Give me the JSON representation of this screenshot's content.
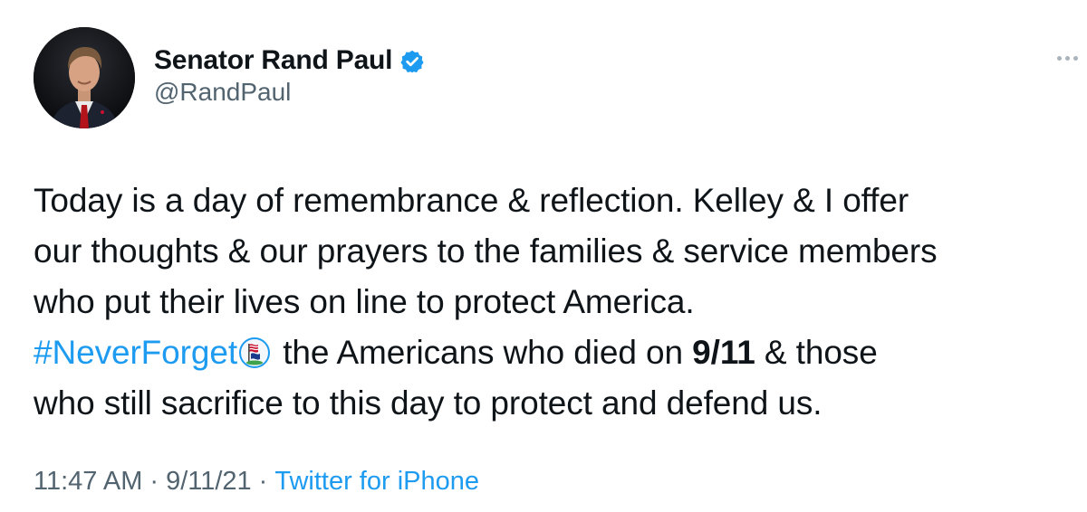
{
  "author": {
    "display_name": "Senator Rand Paul",
    "handle": "@RandPaul",
    "verified": true
  },
  "more_menu": {
    "icon": "more-horizontal-icon"
  },
  "tweet": {
    "line1": "Today is a day of remembrance & reflection. Kelley & I offer",
    "line2": "our thoughts & our prayers to the families & service members",
    "line3": "who put their lives on line to protect America.",
    "hashtag": "#NeverForget",
    "hashflag_icon": "flag-hashflag-icon",
    "line4_a": " the Americans who died on ",
    "line4_bold": "9/11",
    "line4_b": " & those",
    "line5": "who still sacrifice to this day to protect and defend us."
  },
  "meta": {
    "time": "11:47 AM",
    "separator": "·",
    "date": "9/11/21",
    "source": "Twitter for iPhone"
  },
  "colors": {
    "link": "#1d9bf0",
    "text": "#0f1419",
    "secondary": "#536471"
  }
}
